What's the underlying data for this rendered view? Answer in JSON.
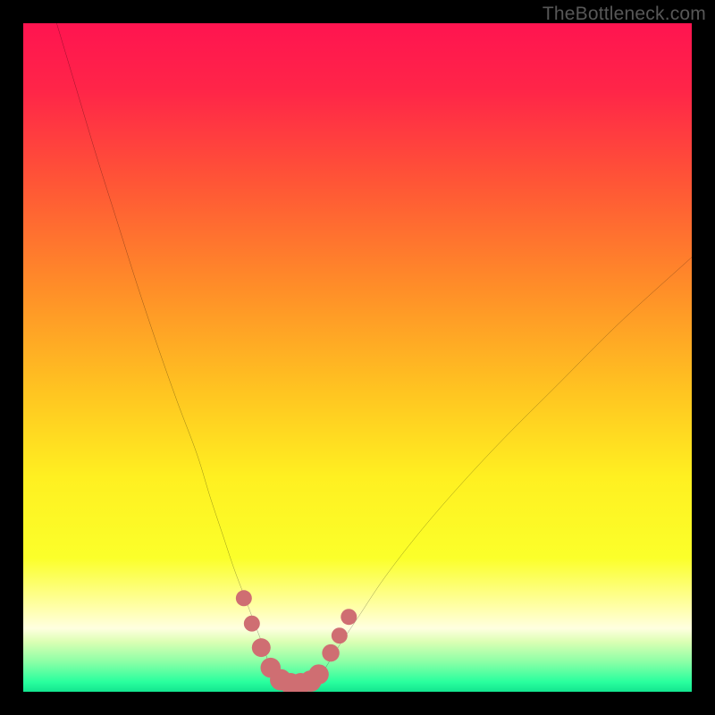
{
  "watermark": "TheBottleneck.com",
  "colors": {
    "black": "#000000",
    "curve_stroke": "#000000",
    "marker_fill": "#cf6e72",
    "marker_stroke": "#cf6e72"
  },
  "chart_data": {
    "type": "line",
    "title": "",
    "xlabel": "",
    "ylabel": "",
    "xlim": [
      0,
      100
    ],
    "ylim": [
      0,
      100
    ],
    "gradient_stops": [
      {
        "offset": 0.0,
        "color": "#ff1450"
      },
      {
        "offset": 0.1,
        "color": "#ff2548"
      },
      {
        "offset": 0.24,
        "color": "#ff5636"
      },
      {
        "offset": 0.4,
        "color": "#ff8f28"
      },
      {
        "offset": 0.55,
        "color": "#ffc421"
      },
      {
        "offset": 0.68,
        "color": "#fff021"
      },
      {
        "offset": 0.8,
        "color": "#fbff2a"
      },
      {
        "offset": 0.875,
        "color": "#ffffab"
      },
      {
        "offset": 0.905,
        "color": "#ffffe0"
      },
      {
        "offset": 0.925,
        "color": "#dcffb4"
      },
      {
        "offset": 0.955,
        "color": "#8cffa6"
      },
      {
        "offset": 0.985,
        "color": "#2aff9e"
      },
      {
        "offset": 1.0,
        "color": "#13e58f"
      }
    ],
    "series": [
      {
        "name": "left_curve",
        "x": [
          5,
          8,
          11,
          14,
          17,
          20,
          23,
          26,
          28,
          30,
          31.5,
          33,
          34.5,
          36,
          37
        ],
        "y": [
          100,
          90,
          80,
          70.5,
          61,
          52,
          43.5,
          35.5,
          29,
          23,
          18.5,
          14.5,
          10.5,
          6.5,
          3.2
        ]
      },
      {
        "name": "right_curve",
        "x": [
          45,
          47,
          50,
          54,
          59,
          65,
          72,
          80,
          89,
          100
        ],
        "y": [
          3.2,
          6.5,
          11,
          17,
          23.5,
          30.5,
          38,
          46,
          55,
          65
        ]
      },
      {
        "name": "valley_floor",
        "x": [
          37,
          38.5,
          40,
          41.5,
          43,
          44.5,
          45
        ],
        "y": [
          3.2,
          1.5,
          1.0,
          1.0,
          1.2,
          2.0,
          3.2
        ]
      }
    ],
    "markers": [
      {
        "x": 33.0,
        "y": 14.0,
        "r": 1.2
      },
      {
        "x": 34.2,
        "y": 10.2,
        "r": 1.2
      },
      {
        "x": 35.6,
        "y": 6.6,
        "r": 1.4
      },
      {
        "x": 37.0,
        "y": 3.6,
        "r": 1.5
      },
      {
        "x": 38.5,
        "y": 1.8,
        "r": 1.6
      },
      {
        "x": 40.0,
        "y": 1.2,
        "r": 1.6
      },
      {
        "x": 41.5,
        "y": 1.2,
        "r": 1.6
      },
      {
        "x": 43.0,
        "y": 1.6,
        "r": 1.6
      },
      {
        "x": 44.2,
        "y": 2.6,
        "r": 1.5
      },
      {
        "x": 46.0,
        "y": 5.8,
        "r": 1.3
      },
      {
        "x": 47.3,
        "y": 8.4,
        "r": 1.2
      },
      {
        "x": 48.7,
        "y": 11.2,
        "r": 1.2
      }
    ]
  }
}
